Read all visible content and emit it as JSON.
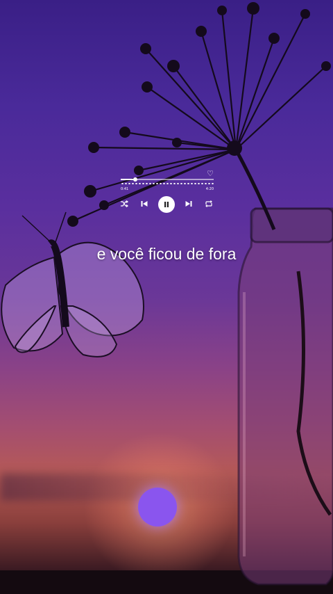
{
  "player": {
    "time_elapsed": "0:41",
    "time_total": "4:20",
    "progress": 0.16,
    "icons": [
      "heart-icon",
      "shuffle-icon",
      "previous-icon",
      "pause-icon",
      "next-icon",
      "repeat-icon"
    ]
  },
  "lyric": {
    "line": "e você ficou de fora"
  },
  "colors": {
    "sky_top": "#3a1f86",
    "sun": "#8a55ee",
    "horizon": "#b65a55"
  }
}
